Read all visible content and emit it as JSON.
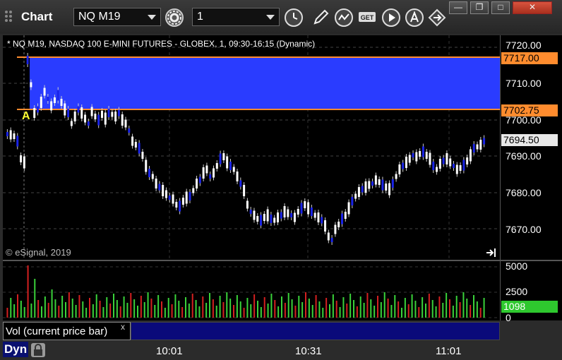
{
  "window": {
    "title": "Chart",
    "controls": {
      "minimize": "—",
      "restore": "❐",
      "maximize": "□",
      "close": "✕"
    }
  },
  "toolbar": {
    "symbol": "NQ M19",
    "interval": "1",
    "tool_icons": [
      "settings-gear-icon",
      "clock-icon",
      "pencil-icon",
      "study-icon",
      "get-icon",
      "play-icon",
      "alert-icon",
      "transfer-icon"
    ]
  },
  "chart": {
    "header": "* NQ M19, NASDAQ 100 E-MINI FUTURES - GLOBEX, 1, 09:30-16:15 (Dynamic)",
    "copyright": "© eSignal, 2019",
    "marker": "A",
    "price_ticks": [
      "7720.00",
      "7710.00",
      "7700.00",
      "7690.00",
      "7680.00",
      "7670.00"
    ],
    "price_tags": {
      "upper": "7717.00",
      "lower": "7702.75",
      "current": "7694.50"
    },
    "colors": {
      "band": "#2a3cff",
      "band_lines": "#ff8c2e",
      "up": "#ffffff",
      "down": "#1a24e8",
      "vol_up": "#3ad23a",
      "vol_down": "#d42020",
      "current_vol": "#2ec82e"
    }
  },
  "volume": {
    "ticks": [
      "5000",
      "2500",
      "0"
    ],
    "current": "1098",
    "legend": "Vol (current price bar)",
    "close_label": "x"
  },
  "time_axis": {
    "labels": [
      "10:01",
      "10:31",
      "11:01"
    ]
  },
  "bottom": {
    "dyn_label": "Dyn"
  }
}
